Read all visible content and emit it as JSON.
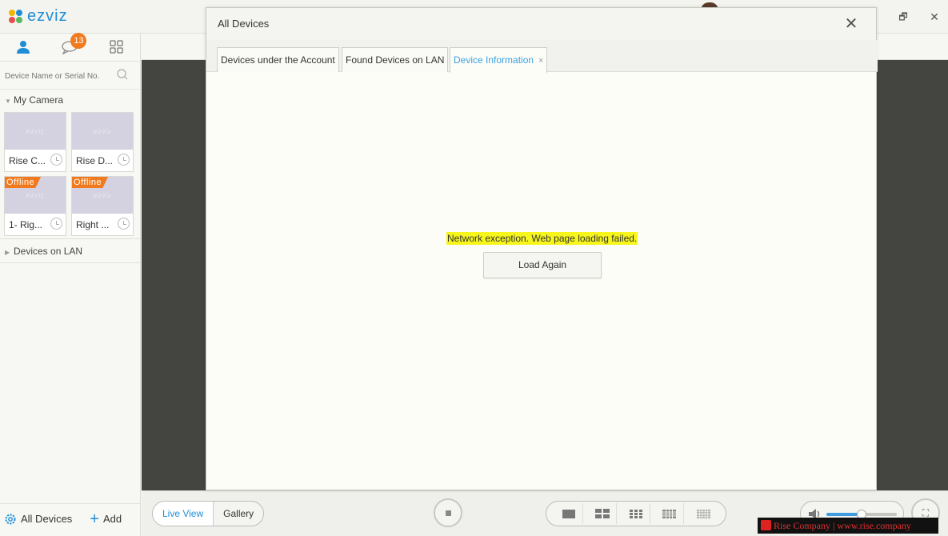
{
  "app": {
    "logo_text": "ezviz",
    "brand_color": "#1f8dd6",
    "accent_orange": "#f07a1d"
  },
  "window": {
    "restore_icon": "restore-icon",
    "close_icon": "close-icon",
    "close_glyph": "✕",
    "restore_glyph": "🗗"
  },
  "sidebar": {
    "tabs": [
      {
        "name": "user-icon"
      },
      {
        "name": "message-icon",
        "badge": "13"
      },
      {
        "name": "grid-icon"
      }
    ],
    "search_placeholder": "Device Name or Serial No.",
    "group_my_camera": "My Camera",
    "cameras": [
      {
        "name": "Rise C...",
        "offline": false
      },
      {
        "name": "Rise D...",
        "offline": false
      },
      {
        "name": "1- Rig...",
        "offline": true
      },
      {
        "name": "Right ...",
        "offline": true
      }
    ],
    "thumb_logo": "ezviz",
    "offline_label": "Offline",
    "group_lan": "Devices on LAN",
    "all_devices": "All Devices",
    "add": "Add"
  },
  "dialog": {
    "title": "All Devices",
    "tabs": [
      {
        "label": "Devices under the Account",
        "active": false
      },
      {
        "label": "Found Devices on LAN",
        "active": false
      },
      {
        "label": "Device Information",
        "active": true,
        "closable": true
      }
    ],
    "tab_close_glyph": "×",
    "error_message": "Network exception. Web page loading failed.",
    "load_again": "Load Again"
  },
  "bottombar": {
    "live_view": "Live View",
    "gallery": "Gallery",
    "volume_level": 0.5,
    "fullscreen_glyph": "⛶"
  },
  "watermark": {
    "text": "Rise Company | www.rise.company"
  }
}
